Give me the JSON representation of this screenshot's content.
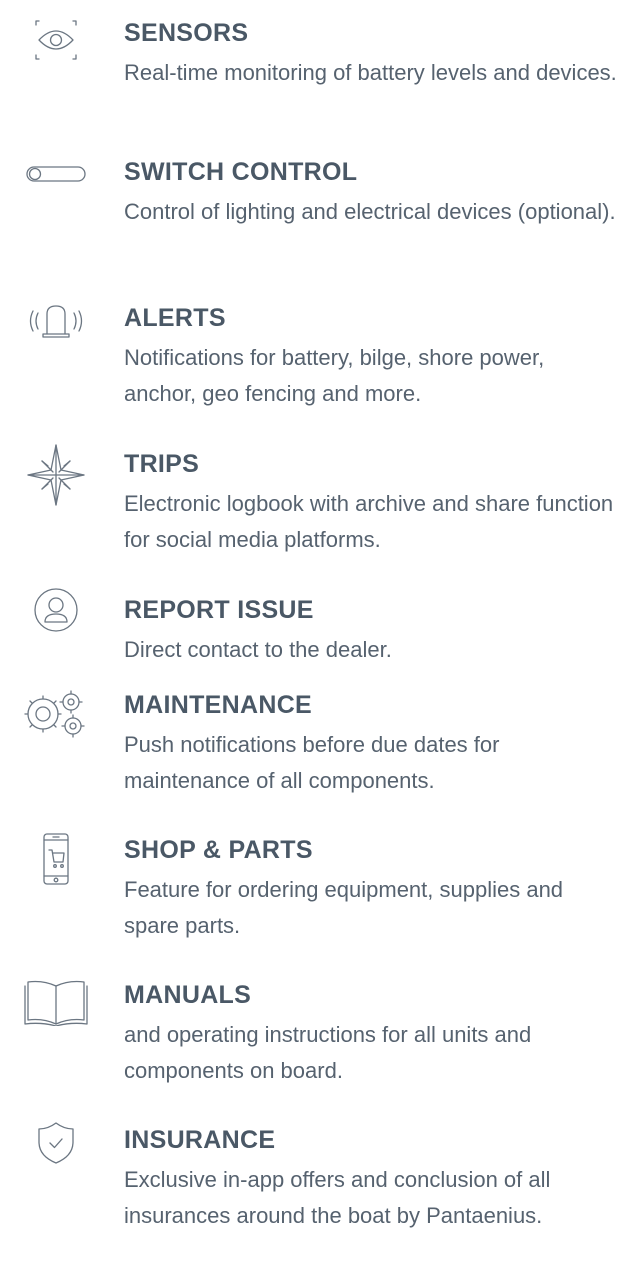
{
  "features": [
    {
      "title": "SENSORS",
      "description": "Real-time monitoring of battery levels and devices.",
      "icon": "eye-scan-icon"
    },
    {
      "title": "SWITCH CONTROL",
      "description": "Control of lighting and electrical devices (optional).",
      "icon": "toggle-switch-icon"
    },
    {
      "title": "ALERTS",
      "description": "Notifications for battery, bilge, shore power, anchor, geo fencing and more.",
      "icon": "alarm-siren-icon"
    },
    {
      "title": "TRIPS",
      "description": "Electronic logbook with archive and share function for social media platforms.",
      "icon": "compass-rose-icon"
    },
    {
      "title": "REPORT ISSUE",
      "description": "Direct contact to the dealer.",
      "icon": "user-circle-icon"
    },
    {
      "title": "MAINTENANCE",
      "description": "Push notifications before due dates for maintenance of all components.",
      "icon": "gears-icon"
    },
    {
      "title": "SHOP & PARTS",
      "description": "Feature for ordering equipment, supplies and spare parts.",
      "icon": "phone-cart-icon"
    },
    {
      "title": "MANUALS",
      "description": "and operating instructions for all units and components on board.",
      "icon": "open-book-icon"
    },
    {
      "title": "INSURANCE",
      "description": "Exclusive in-app offers and conclusion of all insurances around the boat by Pantaenius.",
      "icon": "shield-check-icon"
    }
  ],
  "colors": {
    "text": "#56626f",
    "title": "#4a5866",
    "icon": "#6b7682",
    "background": "#ffffff"
  }
}
